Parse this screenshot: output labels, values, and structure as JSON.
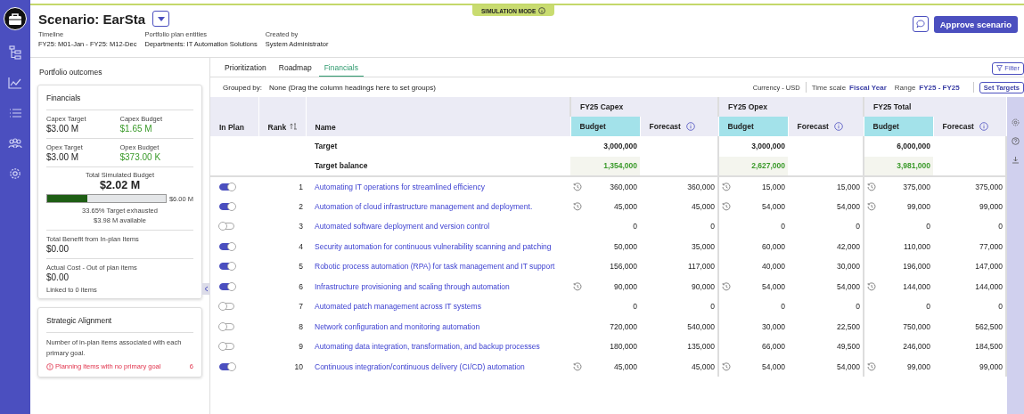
{
  "nav_rail": {
    "items": [
      {
        "kind": "logo",
        "selected": true
      },
      {
        "kind": "tree",
        "selected": false
      },
      {
        "kind": "chart",
        "selected": false
      },
      {
        "kind": "list",
        "selected": false
      },
      {
        "kind": "people",
        "selected": false
      },
      {
        "kind": "gear",
        "selected": false
      }
    ]
  },
  "header": {
    "mode_badge": "SIMULATION MODE",
    "title": "Scenario: EarSta",
    "meta": [
      {
        "label": "Timeline",
        "value": "FY25: M01-Jan - FY25: M12-Dec"
      },
      {
        "label": "Portfolio plan entities",
        "value": "Departments: IT Automation Solutions"
      },
      {
        "label": "Created by",
        "value": "System Administrator"
      }
    ],
    "approve_button": "Approve scenario"
  },
  "left_panel": {
    "title": "Portfolio outcomes",
    "financials": {
      "title": "Financials",
      "pairs": [
        [
          {
            "label": "Capex Target",
            "value": "$3.00 M",
            "positive": false
          },
          {
            "label": "Capex Budget",
            "value": "$1.65 M",
            "positive": true
          }
        ],
        [
          {
            "label": "Opex Target",
            "value": "$3.00 M",
            "positive": false
          },
          {
            "label": "Opex Budget",
            "value": "$373.00 K",
            "positive": true
          }
        ]
      ],
      "total_label": "Total Simulated Budget",
      "total_value": "$2.02 M",
      "level": 0.3365,
      "bar_max": "$6.00 M",
      "exhausted": "33.65% Target exhausted",
      "available": "$3.98 M available",
      "benefit_label": "Total Benefit from In-plan Items",
      "benefit_value": "$0.00",
      "actual_label": "Actual Cost - Out of plan items",
      "actual_value": "$0.00",
      "linked": "Linked to 0 items"
    },
    "strategic": {
      "title": "Strategic Alignment",
      "description": "Number of in-plan items associated with each primary goal.",
      "warning": "Planning items with no primary goal",
      "warning_count": "6"
    }
  },
  "tabs": [
    {
      "label": "Prioritization",
      "selected": false
    },
    {
      "label": "Roadmap",
      "selected": false
    },
    {
      "label": "Financials",
      "selected": true
    }
  ],
  "filter_button": "Filter",
  "toolbar": {
    "grouped_label": "Grouped by:",
    "grouped_value": "None (Drag the column headings here to set groups)",
    "currency": "Currency - USD",
    "time_scale_label": "Time scale",
    "time_scale": "Fiscal Year",
    "range_label": "Range",
    "range": "FY25 - FY25",
    "set_targets": "Set Targets"
  },
  "table": {
    "columns": [
      "In Plan",
      "Rank",
      "Name"
    ],
    "groups": [
      {
        "title": "FY25 Capex",
        "sub_columns": [
          "Budget",
          "Forecast"
        ]
      },
      {
        "title": "FY25 Opex",
        "sub_columns": [
          "Budget",
          "Forecast"
        ]
      },
      {
        "title": "FY25 Total",
        "sub_columns": [
          "Budget",
          "Forecast"
        ]
      }
    ],
    "summary_rows": [
      {
        "label": "Target",
        "values": [
          "3,000,000",
          "3,000,000",
          "6,000,000"
        ],
        "positive": false
      },
      {
        "label": "Target balance",
        "values": [
          "1,354,000",
          "2,627,000",
          "3,981,000"
        ],
        "positive": true
      }
    ],
    "rows": [
      {
        "in_plan": true,
        "rank": "1",
        "name": "Automating IT operations for streamlined efficiency",
        "history": true,
        "values": [
          [
            "360,000",
            "360,000"
          ],
          [
            "15,000",
            "15,000"
          ],
          [
            "375,000",
            "375,000"
          ]
        ]
      },
      {
        "in_plan": true,
        "rank": "2",
        "name": "Automation of cloud infrastructure management and deployment.",
        "history": true,
        "values": [
          [
            "45,000",
            "45,000"
          ],
          [
            "54,000",
            "54,000"
          ],
          [
            "99,000",
            "99,000"
          ]
        ]
      },
      {
        "in_plan": false,
        "rank": "3",
        "name": "Automated software deployment and version control",
        "history": false,
        "values": [
          [
            "0",
            "0"
          ],
          [
            "0",
            "0"
          ],
          [
            "0",
            "0"
          ]
        ]
      },
      {
        "in_plan": true,
        "rank": "4",
        "name": "Security automation for continuous vulnerability scanning and patching",
        "history": false,
        "values": [
          [
            "50,000",
            "35,000"
          ],
          [
            "60,000",
            "42,000"
          ],
          [
            "110,000",
            "77,000"
          ]
        ]
      },
      {
        "in_plan": true,
        "rank": "5",
        "name": "Robotic process automation (RPA) for task management and IT support",
        "history": false,
        "values": [
          [
            "156,000",
            "117,000"
          ],
          [
            "40,000",
            "30,000"
          ],
          [
            "196,000",
            "147,000"
          ]
        ]
      },
      {
        "in_plan": true,
        "rank": "6",
        "name": "Infrastructure provisioning and scaling through automation",
        "history": true,
        "values": [
          [
            "90,000",
            "90,000"
          ],
          [
            "54,000",
            "54,000"
          ],
          [
            "144,000",
            "144,000"
          ]
        ]
      },
      {
        "in_plan": false,
        "rank": "7",
        "name": "Automated patch management across IT systems",
        "history": false,
        "values": [
          [
            "0",
            "0"
          ],
          [
            "0",
            "0"
          ],
          [
            "0",
            "0"
          ]
        ]
      },
      {
        "in_plan": false,
        "rank": "8",
        "name": "Network configuration and monitoring automation",
        "history": false,
        "values": [
          [
            "720,000",
            "540,000"
          ],
          [
            "30,000",
            "22,500"
          ],
          [
            "750,000",
            "562,500"
          ]
        ]
      },
      {
        "in_plan": false,
        "rank": "9",
        "name": "Automating data integration, transformation, and backup processes",
        "history": false,
        "values": [
          [
            "180,000",
            "135,000"
          ],
          [
            "66,000",
            "49,500"
          ],
          [
            "246,000",
            "184,500"
          ]
        ]
      },
      {
        "in_plan": true,
        "rank": "10",
        "name": "Continuous integration/continuous delivery (CI/CD) automation",
        "history": true,
        "values": [
          [
            "45,000",
            "45,000"
          ],
          [
            "54,000",
            "54,000"
          ],
          [
            "99,000",
            "99,000"
          ]
        ]
      }
    ]
  }
}
